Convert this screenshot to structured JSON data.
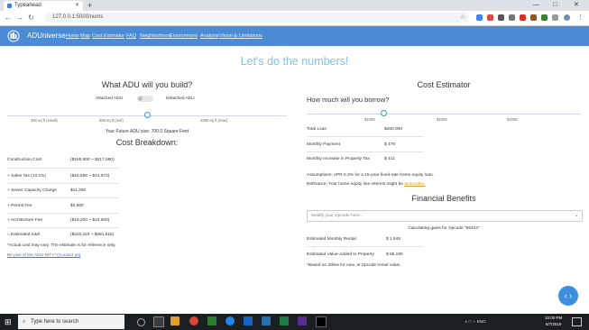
{
  "browser": {
    "tab_title": "Typeahead",
    "new_tab": "+",
    "url": "127.0.0.1:5000/nums",
    "window_controls": [
      "—",
      "□",
      "✕"
    ]
  },
  "navbar": {
    "brand": "ADUniverse",
    "links": [
      "Home",
      "Map",
      "Cost Estimator",
      "FAQ",
      "Neighborhood",
      "Environment",
      "Analysis",
      "Vision & Limitations"
    ]
  },
  "headline": "Let's do the numbers!",
  "left": {
    "build_title": "What ADU will you build?",
    "toggle_left": "Attached ADU",
    "toggle_right": "Detached ADU",
    "slider_ticks": [
      "300 sq ft (small)",
      "650 sq ft (mid)",
      "1000 sq ft (max)"
    ],
    "slider_value": 0.5,
    "size_text": "Your Future ADU size: 700.0 Square Feet",
    "breakdown_title": "Cost Breakdown:",
    "rows": [
      {
        "label": "Construction Cost",
        "value": "($165,900 ~ $217,560)"
      },
      {
        "label": "+ Sales Tax (10.1%)",
        "value": "($16,656 ~ $21,974)"
      },
      {
        "label": "+ Sewer Capacity Charge",
        "value": "$11,206"
      },
      {
        "label": "+ Permit Fee",
        "value": "$3,500"
      },
      {
        "label": "+ Architecture Fee",
        "value": "($19,200 ~ $24,800)"
      },
      {
        "label": "= Estimated total",
        "value": "($220,119 ~ $281,516)"
      }
    ],
    "note": "*Actual cost may vary. The estimate is for reference only.",
    "link": "Be part of the ADU-NITY! (Contact us)"
  },
  "right": {
    "estimator_title": "Cost Estimator",
    "borrow_title": "How much will you borrow?",
    "slider_ticks": [
      "$100K",
      "$150K",
      "$200K"
    ],
    "slider_value": 0.28,
    "rows": [
      {
        "label": "Total Loan",
        "value": "$260,000"
      },
      {
        "label": "Monthly Payment",
        "value": "$ 478"
      },
      {
        "label": "Monthly Increase in Property Tax",
        "value": "$ 411"
      }
    ],
    "assumption": "Assumptions: APR 5.3% for a 15-year fixed-rate home equity loan.",
    "refinance_prefix": "Refinance: Your home equity line interest might be ",
    "refinance_link": "deductible.",
    "benefits_title": "Financial Benefits",
    "select_placeholder": "Modify your zipcode here...",
    "select_caret": "⌄",
    "zip_text": "Calculating gains for zipcode \"98103\"",
    "gains": [
      {
        "label": "Estimated Monthly Rental",
        "value": "$ 1,548"
      },
      {
        "label": "Estimated Value-Added to Property",
        "value": "$ 85,190"
      }
    ],
    "footnote": "*Based on Zillow for now, at zipcode rental value."
  },
  "fab_label": "‹ ›",
  "taskbar": {
    "search_placeholder": "Type here to search",
    "tray_text": "∧  □  ☼  ENG",
    "time": "10:00 PM",
    "date": "6/7/2019"
  },
  "colors": {
    "navbar": "#4b8bd3",
    "headline": "#7ec3ea",
    "link": "#3a7bd5"
  }
}
